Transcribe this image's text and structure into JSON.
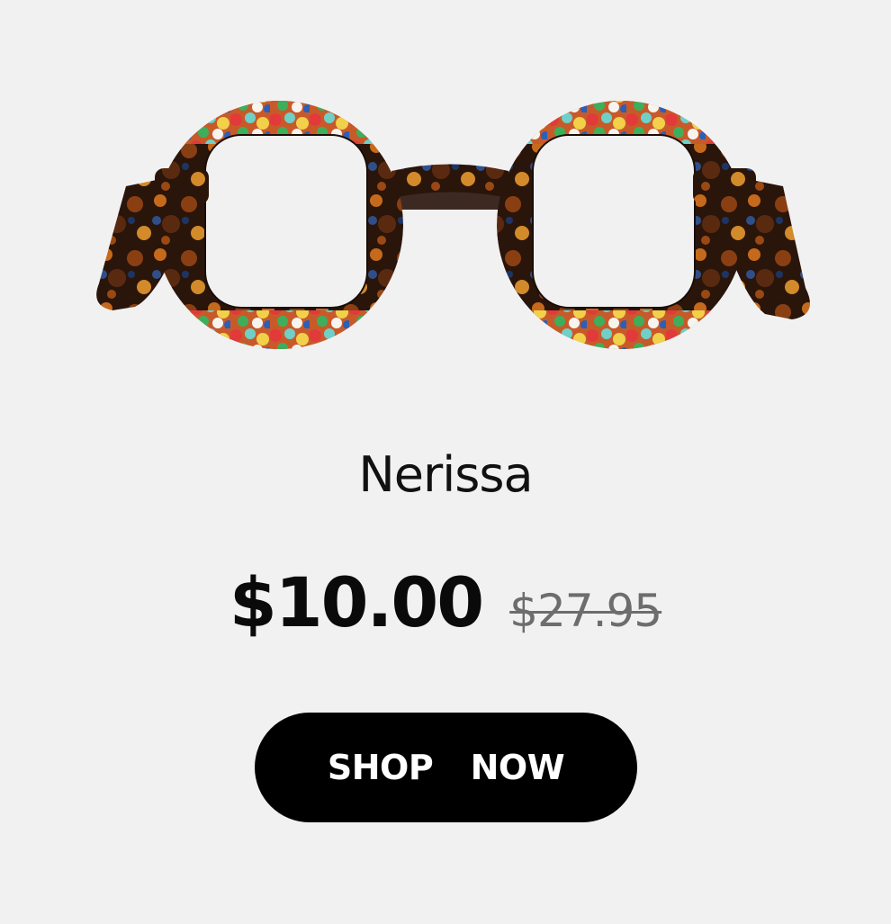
{
  "product": {
    "name": "Nerissa",
    "price_sale": "$10.00",
    "price_original": "$27.95",
    "image_icon": "eyeglasses-icon"
  },
  "cta": {
    "label": "SHOP  NOW"
  },
  "colors": {
    "background": "#f2f1f1",
    "button": "#000000",
    "button_text": "#ffffff",
    "sale_price": "#0a0a0a",
    "original_price": "#6d6d6d",
    "frame_tortoise": "#3a1e10"
  }
}
